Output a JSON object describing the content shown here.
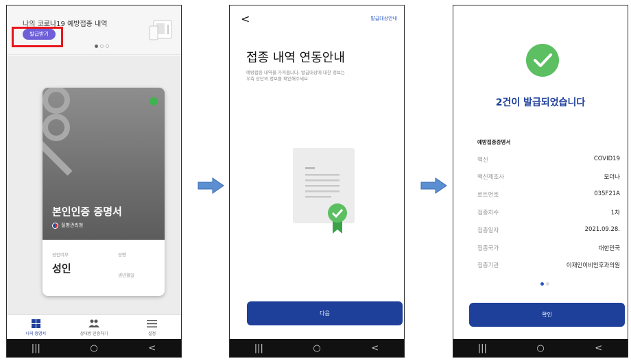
{
  "accent_color": "#1e3f9a",
  "highlight_color": "#e8161c",
  "screen1": {
    "header_title": "나의 코로나19 예방접종 내역",
    "issue_button": "발급받기",
    "card_title": "본인인증 증명서",
    "issuer": "질병관리청",
    "label_adult_status": "성인여부",
    "label_name": "성명",
    "label_birth": "생년월일",
    "adult_value": "성인",
    "tabs": [
      {
        "label": "나의 증명서",
        "icon": "grid-icon"
      },
      {
        "label": "상대방 인증하기",
        "icon": "people-icon"
      },
      {
        "label": "설정",
        "icon": "menu-icon"
      }
    ]
  },
  "screen2": {
    "back": "<",
    "top_link": "발급대상안내",
    "title": "접종 내역 연동안내",
    "description_line1": "예방접종 내역을 가져옵니다. 발급대상에 대한 정보는",
    "description_line2": "우측 상단의 정보를 확인해주세요",
    "next_button": "다음"
  },
  "screen3": {
    "title": "2건이 발급되었습니다",
    "section_title": "예방접종증명서",
    "rows": [
      {
        "key": "백신",
        "value": "COVID19"
      },
      {
        "key": "백신제조사",
        "value": "모더나"
      },
      {
        "key": "로트번호",
        "value": "035F21A"
      },
      {
        "key": "접종차수",
        "value": "1차"
      },
      {
        "key": "접종일자",
        "value": "2021.09.28."
      },
      {
        "key": "접종국가",
        "value": "대한민국"
      },
      {
        "key": "접종기관",
        "value": "이재민이비인후과의원"
      }
    ],
    "confirm_button": "확인"
  },
  "android_nav": {
    "recent": "|||",
    "home": "○",
    "back": "<"
  }
}
